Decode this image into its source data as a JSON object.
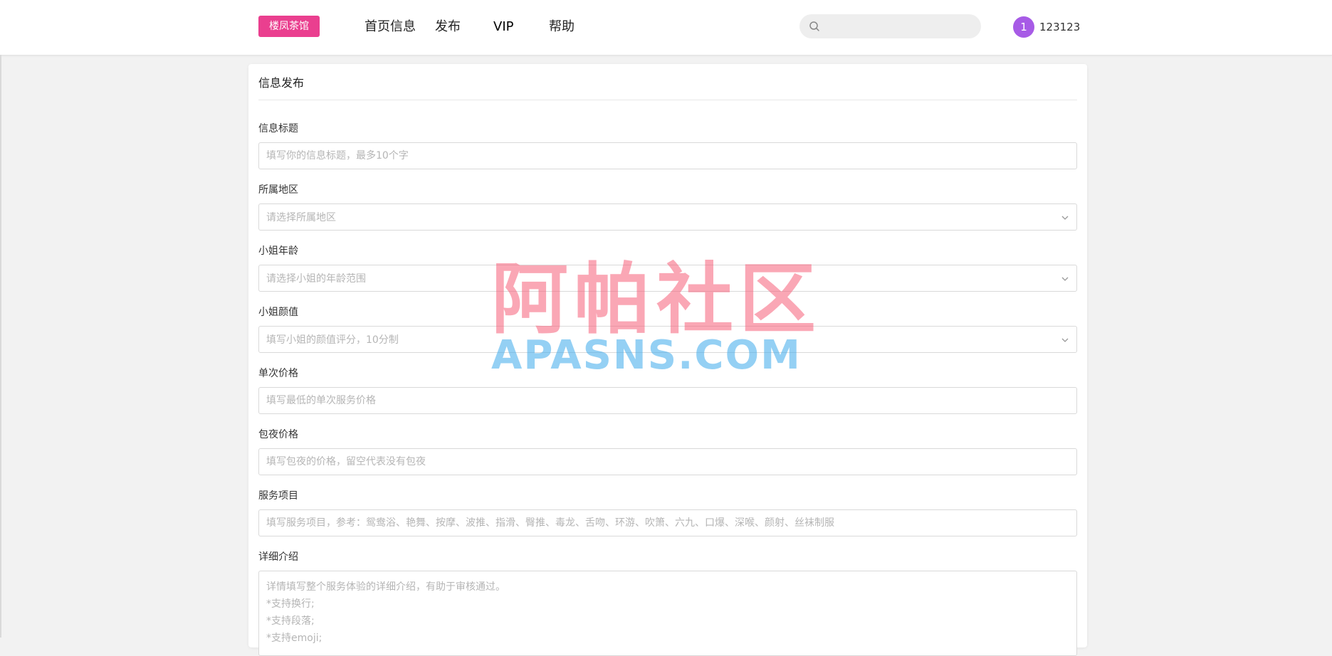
{
  "header": {
    "logo_text": "楼凤茶馆",
    "nav": {
      "home": "首页信息",
      "publish": "发布",
      "vip": "VIP",
      "help": "帮助"
    },
    "search": {
      "placeholder": "",
      "value": ""
    },
    "user": {
      "avatar_text": "1",
      "name": "123123"
    }
  },
  "form": {
    "title": "信息发布",
    "fields": {
      "title": {
        "label": "信息标题",
        "placeholder": "填写你的信息标题，最多10个字"
      },
      "region": {
        "label": "所属地区",
        "placeholder": "请选择所属地区"
      },
      "age": {
        "label": "小姐年龄",
        "placeholder": "请选择小姐的年龄范围"
      },
      "looks": {
        "label": "小姐颜值",
        "placeholder": "填写小姐的颜值评分，10分制"
      },
      "single_price": {
        "label": "单次价格",
        "placeholder": "填写最低的单次服务价格"
      },
      "night_price": {
        "label": "包夜价格",
        "placeholder": "填写包夜的价格，留空代表没有包夜"
      },
      "services": {
        "label": "服务项目",
        "placeholder": "填写服务项目，参考：鸳鸯浴、艳舞、按摩、波推、指滑、臀推、毒龙、舌吻、环游、吹箫、六九、口爆、深喉、颜射、丝袜制服"
      },
      "description": {
        "label": "详细介绍",
        "placeholder_lines": [
          "详情填写整个服务体验的详细介绍，有助于审核通过。",
          "*支持换行;",
          "*支持段落;",
          "*支持emoji;"
        ]
      }
    }
  },
  "watermark": {
    "cn": "阿帕社区",
    "en": "APASNS.COM"
  },
  "colors": {
    "brand": "#ea3f8f",
    "avatar": "#a75be6"
  }
}
